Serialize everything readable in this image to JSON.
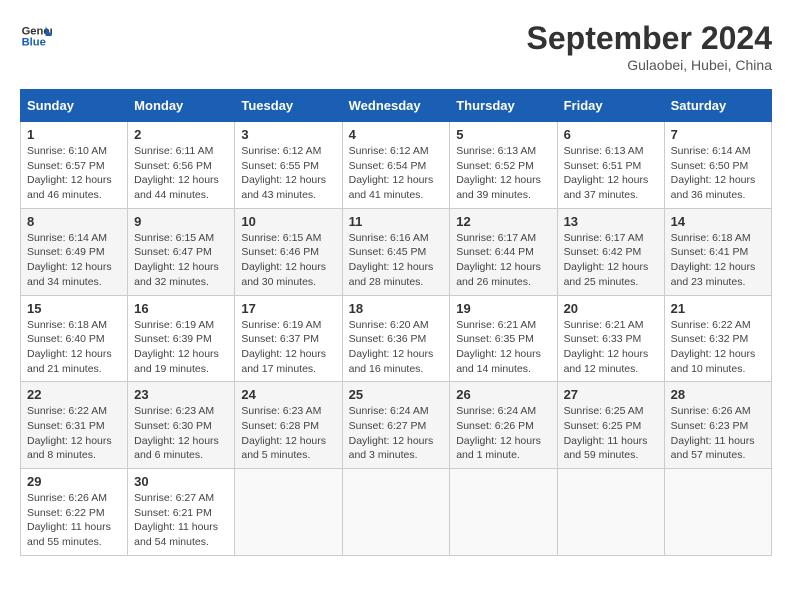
{
  "header": {
    "logo_line1": "General",
    "logo_line2": "Blue",
    "month_title": "September 2024",
    "location": "Gulaobei, Hubei, China"
  },
  "weekdays": [
    "Sunday",
    "Monday",
    "Tuesday",
    "Wednesday",
    "Thursday",
    "Friday",
    "Saturday"
  ],
  "weeks": [
    [
      {
        "day": "1",
        "sunrise": "6:10 AM",
        "sunset": "6:57 PM",
        "daylight": "12 hours and 46 minutes."
      },
      {
        "day": "2",
        "sunrise": "6:11 AM",
        "sunset": "6:56 PM",
        "daylight": "12 hours and 44 minutes."
      },
      {
        "day": "3",
        "sunrise": "6:12 AM",
        "sunset": "6:55 PM",
        "daylight": "12 hours and 43 minutes."
      },
      {
        "day": "4",
        "sunrise": "6:12 AM",
        "sunset": "6:54 PM",
        "daylight": "12 hours and 41 minutes."
      },
      {
        "day": "5",
        "sunrise": "6:13 AM",
        "sunset": "6:52 PM",
        "daylight": "12 hours and 39 minutes."
      },
      {
        "day": "6",
        "sunrise": "6:13 AM",
        "sunset": "6:51 PM",
        "daylight": "12 hours and 37 minutes."
      },
      {
        "day": "7",
        "sunrise": "6:14 AM",
        "sunset": "6:50 PM",
        "daylight": "12 hours and 36 minutes."
      }
    ],
    [
      {
        "day": "8",
        "sunrise": "6:14 AM",
        "sunset": "6:49 PM",
        "daylight": "12 hours and 34 minutes."
      },
      {
        "day": "9",
        "sunrise": "6:15 AM",
        "sunset": "6:47 PM",
        "daylight": "12 hours and 32 minutes."
      },
      {
        "day": "10",
        "sunrise": "6:15 AM",
        "sunset": "6:46 PM",
        "daylight": "12 hours and 30 minutes."
      },
      {
        "day": "11",
        "sunrise": "6:16 AM",
        "sunset": "6:45 PM",
        "daylight": "12 hours and 28 minutes."
      },
      {
        "day": "12",
        "sunrise": "6:17 AM",
        "sunset": "6:44 PM",
        "daylight": "12 hours and 26 minutes."
      },
      {
        "day": "13",
        "sunrise": "6:17 AM",
        "sunset": "6:42 PM",
        "daylight": "12 hours and 25 minutes."
      },
      {
        "day": "14",
        "sunrise": "6:18 AM",
        "sunset": "6:41 PM",
        "daylight": "12 hours and 23 minutes."
      }
    ],
    [
      {
        "day": "15",
        "sunrise": "6:18 AM",
        "sunset": "6:40 PM",
        "daylight": "12 hours and 21 minutes."
      },
      {
        "day": "16",
        "sunrise": "6:19 AM",
        "sunset": "6:39 PM",
        "daylight": "12 hours and 19 minutes."
      },
      {
        "day": "17",
        "sunrise": "6:19 AM",
        "sunset": "6:37 PM",
        "daylight": "12 hours and 17 minutes."
      },
      {
        "day": "18",
        "sunrise": "6:20 AM",
        "sunset": "6:36 PM",
        "daylight": "12 hours and 16 minutes."
      },
      {
        "day": "19",
        "sunrise": "6:21 AM",
        "sunset": "6:35 PM",
        "daylight": "12 hours and 14 minutes."
      },
      {
        "day": "20",
        "sunrise": "6:21 AM",
        "sunset": "6:33 PM",
        "daylight": "12 hours and 12 minutes."
      },
      {
        "day": "21",
        "sunrise": "6:22 AM",
        "sunset": "6:32 PM",
        "daylight": "12 hours and 10 minutes."
      }
    ],
    [
      {
        "day": "22",
        "sunrise": "6:22 AM",
        "sunset": "6:31 PM",
        "daylight": "12 hours and 8 minutes."
      },
      {
        "day": "23",
        "sunrise": "6:23 AM",
        "sunset": "6:30 PM",
        "daylight": "12 hours and 6 minutes."
      },
      {
        "day": "24",
        "sunrise": "6:23 AM",
        "sunset": "6:28 PM",
        "daylight": "12 hours and 5 minutes."
      },
      {
        "day": "25",
        "sunrise": "6:24 AM",
        "sunset": "6:27 PM",
        "daylight": "12 hours and 3 minutes."
      },
      {
        "day": "26",
        "sunrise": "6:24 AM",
        "sunset": "6:26 PM",
        "daylight": "12 hours and 1 minute."
      },
      {
        "day": "27",
        "sunrise": "6:25 AM",
        "sunset": "6:25 PM",
        "daylight": "11 hours and 59 minutes."
      },
      {
        "day": "28",
        "sunrise": "6:26 AM",
        "sunset": "6:23 PM",
        "daylight": "11 hours and 57 minutes."
      }
    ],
    [
      {
        "day": "29",
        "sunrise": "6:26 AM",
        "sunset": "6:22 PM",
        "daylight": "11 hours and 55 minutes."
      },
      {
        "day": "30",
        "sunrise": "6:27 AM",
        "sunset": "6:21 PM",
        "daylight": "11 hours and 54 minutes."
      },
      null,
      null,
      null,
      null,
      null
    ]
  ]
}
